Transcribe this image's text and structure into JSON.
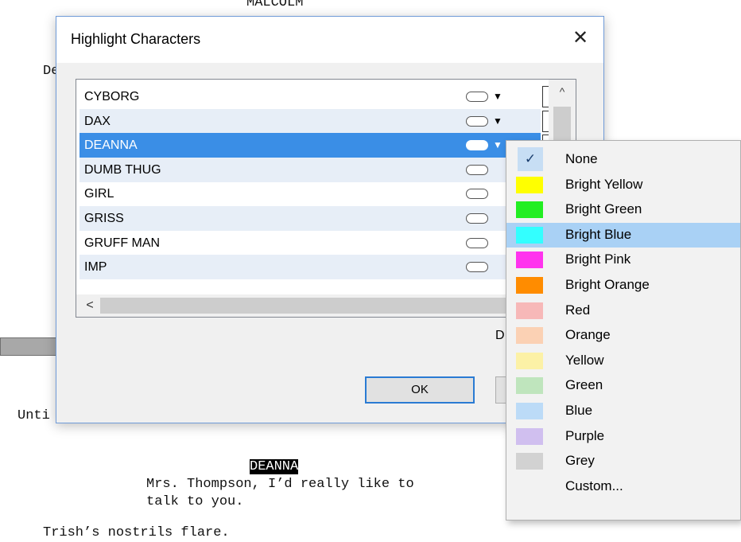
{
  "background": {
    "top_char": "MALCOLM",
    "left_fragment": "De",
    "until_fragment": "Unti",
    "character_cue": "DEANNA",
    "dialogue_line1": "Mrs. Thompson, I’d really like to",
    "dialogue_line2": "talk to you.",
    "action_line": "Trish’s nostrils flare."
  },
  "dialog": {
    "title": "Highlight Characters",
    "close_icon": "close-icon",
    "characters": [
      {
        "name": "CYBORG"
      },
      {
        "name": "DAX"
      },
      {
        "name": "DEANNA",
        "selected": true
      },
      {
        "name": "DUMB THUG"
      },
      {
        "name": "GIRL"
      },
      {
        "name": "GRISS"
      },
      {
        "name": "GRUFF MAN"
      },
      {
        "name": "IMP"
      }
    ],
    "scroll_up_glyph": "^",
    "scroll_left_glyph": "<",
    "cut_label": "D",
    "ok_label": "OK"
  },
  "color_menu": {
    "items": [
      {
        "label": "None",
        "color": null,
        "checked": true
      },
      {
        "label": "Bright Yellow",
        "color": "#ffff00"
      },
      {
        "label": "Bright Green",
        "color": "#22ee22"
      },
      {
        "label": "Bright Blue",
        "color": "#33ffff",
        "hover": true
      },
      {
        "label": "Bright Pink",
        "color": "#ff33ee"
      },
      {
        "label": "Bright Orange",
        "color": "#ff8c00"
      },
      {
        "label": "Red",
        "color": "#f7b8b8"
      },
      {
        "label": "Orange",
        "color": "#fbd1b4"
      },
      {
        "label": "Yellow",
        "color": "#fcf1a6"
      },
      {
        "label": "Green",
        "color": "#bfe5bd"
      },
      {
        "label": "Blue",
        "color": "#bcdbf7"
      },
      {
        "label": "Purple",
        "color": "#d0bfef"
      },
      {
        "label": "Grey",
        "color": "#d2d2d2"
      },
      {
        "label": "Custom...",
        "color": null
      }
    ]
  }
}
